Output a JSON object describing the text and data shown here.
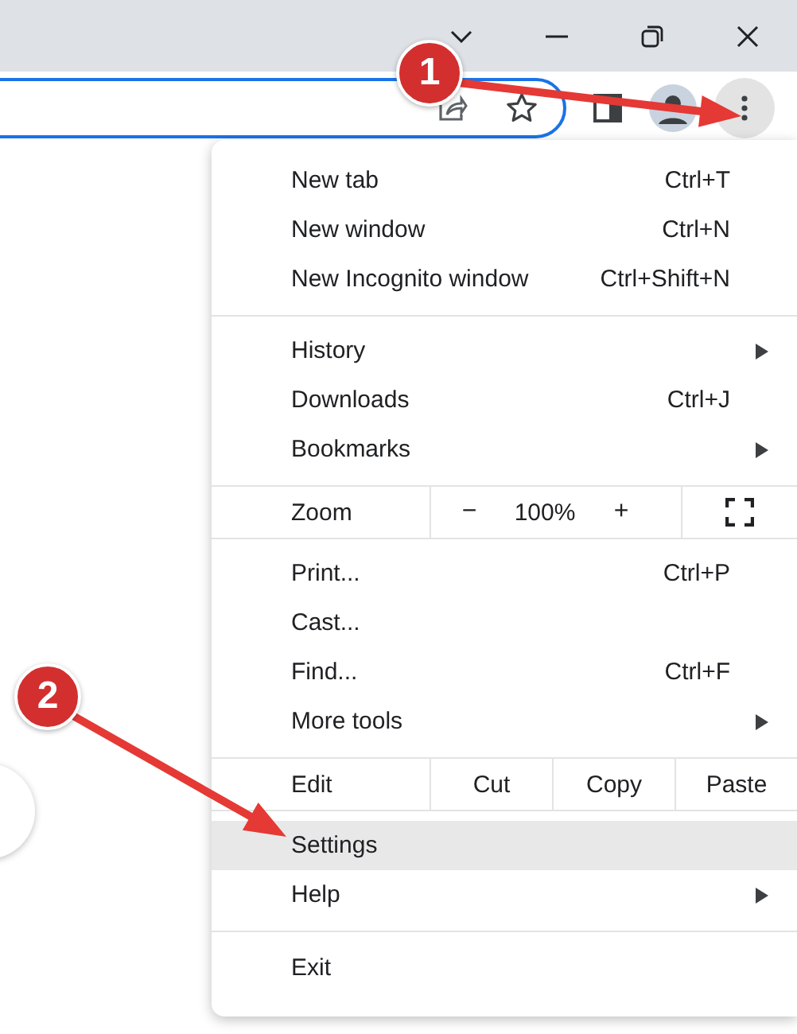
{
  "menu": {
    "sections": [
      {
        "kind": "list",
        "items": [
          {
            "label": "New tab",
            "shortcut": "Ctrl+T",
            "submenu": false,
            "selected": false
          },
          {
            "label": "New window",
            "shortcut": "Ctrl+N",
            "submenu": false,
            "selected": false
          },
          {
            "label": "New Incognito window",
            "shortcut": "Ctrl+Shift+N",
            "submenu": false,
            "selected": false
          }
        ]
      },
      {
        "kind": "list",
        "items": [
          {
            "label": "History",
            "submenu": true,
            "selected": false
          },
          {
            "label": "Downloads",
            "shortcut": "Ctrl+J",
            "submenu": false,
            "selected": false
          },
          {
            "label": "Bookmarks",
            "submenu": true,
            "selected": false
          }
        ]
      },
      {
        "kind": "zoom",
        "label": "Zoom",
        "minus": "−",
        "value": "100%",
        "plus": "+"
      },
      {
        "kind": "list",
        "items": [
          {
            "label": "Print...",
            "shortcut": "Ctrl+P",
            "submenu": false,
            "selected": false
          },
          {
            "label": "Cast...",
            "submenu": false,
            "selected": false
          },
          {
            "label": "Find...",
            "shortcut": "Ctrl+F",
            "submenu": false,
            "selected": false
          },
          {
            "label": "More tools",
            "submenu": true,
            "selected": false
          }
        ]
      },
      {
        "kind": "edit",
        "label": "Edit",
        "buttons": [
          "Cut",
          "Copy",
          "Paste"
        ]
      },
      {
        "kind": "list",
        "items": [
          {
            "label": "Settings",
            "submenu": false,
            "selected": true
          },
          {
            "label": "Help",
            "submenu": true,
            "selected": false
          }
        ]
      },
      {
        "kind": "list",
        "items": [
          {
            "label": "Exit",
            "submenu": false,
            "selected": false
          }
        ]
      }
    ]
  },
  "annotations": [
    {
      "number": "1"
    },
    {
      "number": "2"
    }
  ]
}
